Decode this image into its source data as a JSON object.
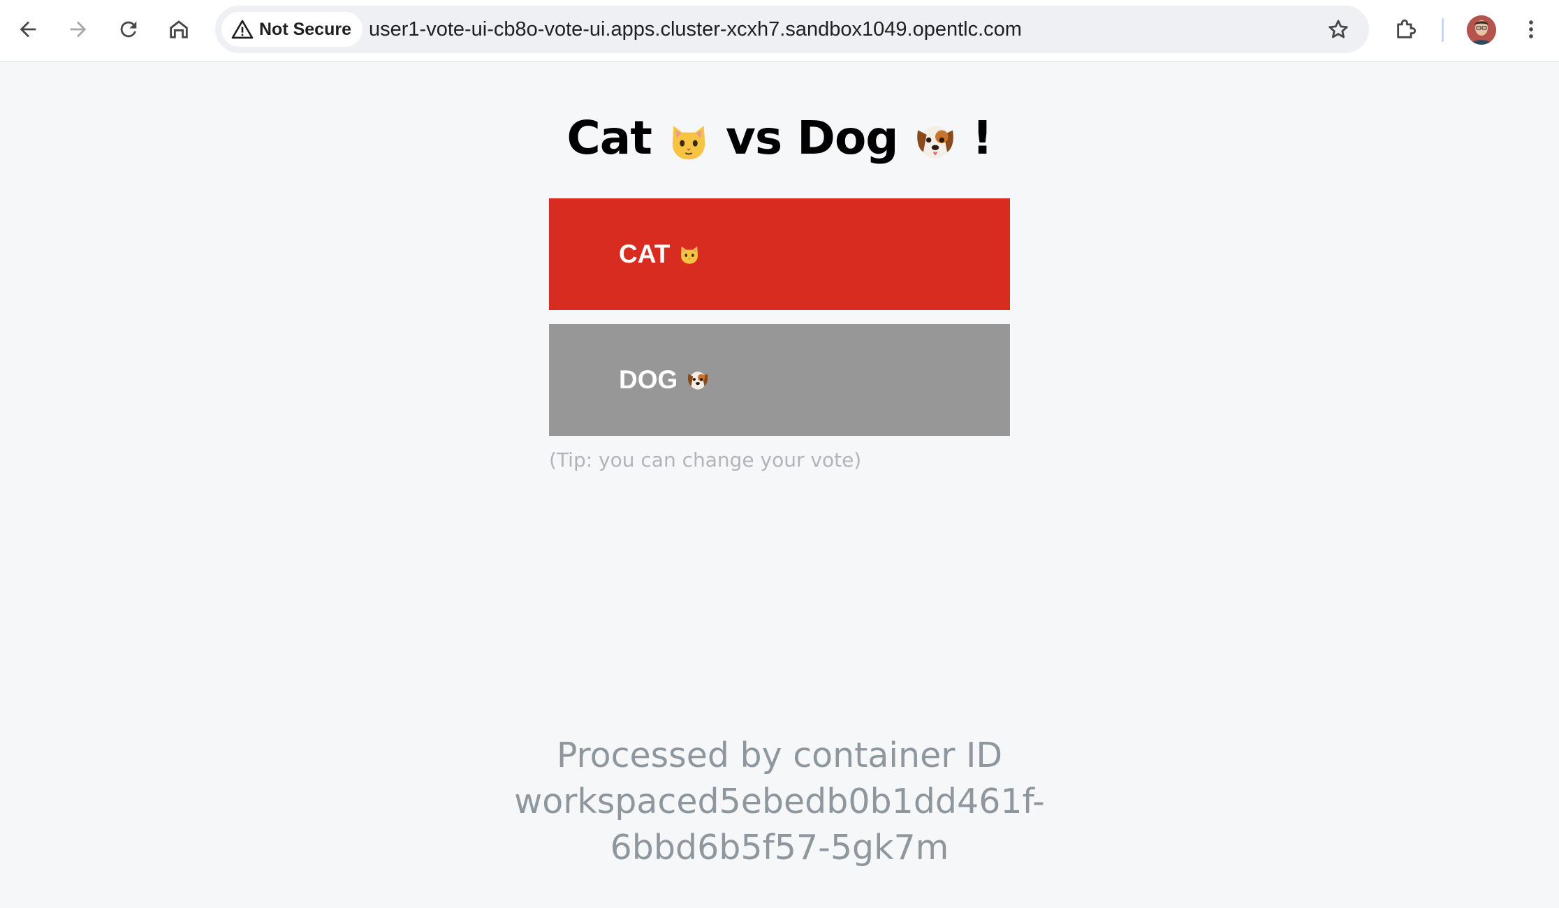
{
  "browser": {
    "security_label": "Not Secure",
    "url": "user1-vote-ui-cb8o-vote-ui.apps.cluster-xcxh7.sandbox1049.opentlc.com",
    "icons": {
      "back": "back-arrow-icon",
      "forward": "forward-arrow-icon",
      "reload": "reload-icon",
      "home": "home-icon",
      "warning": "warning-triangle-icon",
      "bookmark": "star-icon",
      "extensions": "puzzle-icon",
      "menu": "kebab-menu-icon"
    }
  },
  "page": {
    "title_part1": "Cat",
    "title_part2": "vs Dog",
    "title_part3": "!",
    "options": [
      {
        "label": "CAT",
        "emoji": "cat-face",
        "color": "#d92c20"
      },
      {
        "label": "DOG",
        "emoji": "dog-face",
        "color": "#979797"
      }
    ],
    "tip": "(Tip: you can change your vote)",
    "processed_line1": "Processed by container ID",
    "processed_line2": "workspaced5ebedb0b1dd461f-",
    "processed_line3": "6bbd6b5f57-5gk7m"
  },
  "colors": {
    "accent_cat": "#d92c20",
    "dog_gray": "#979797",
    "background": "#f6f7f9",
    "muted_text": "#8e979e"
  }
}
